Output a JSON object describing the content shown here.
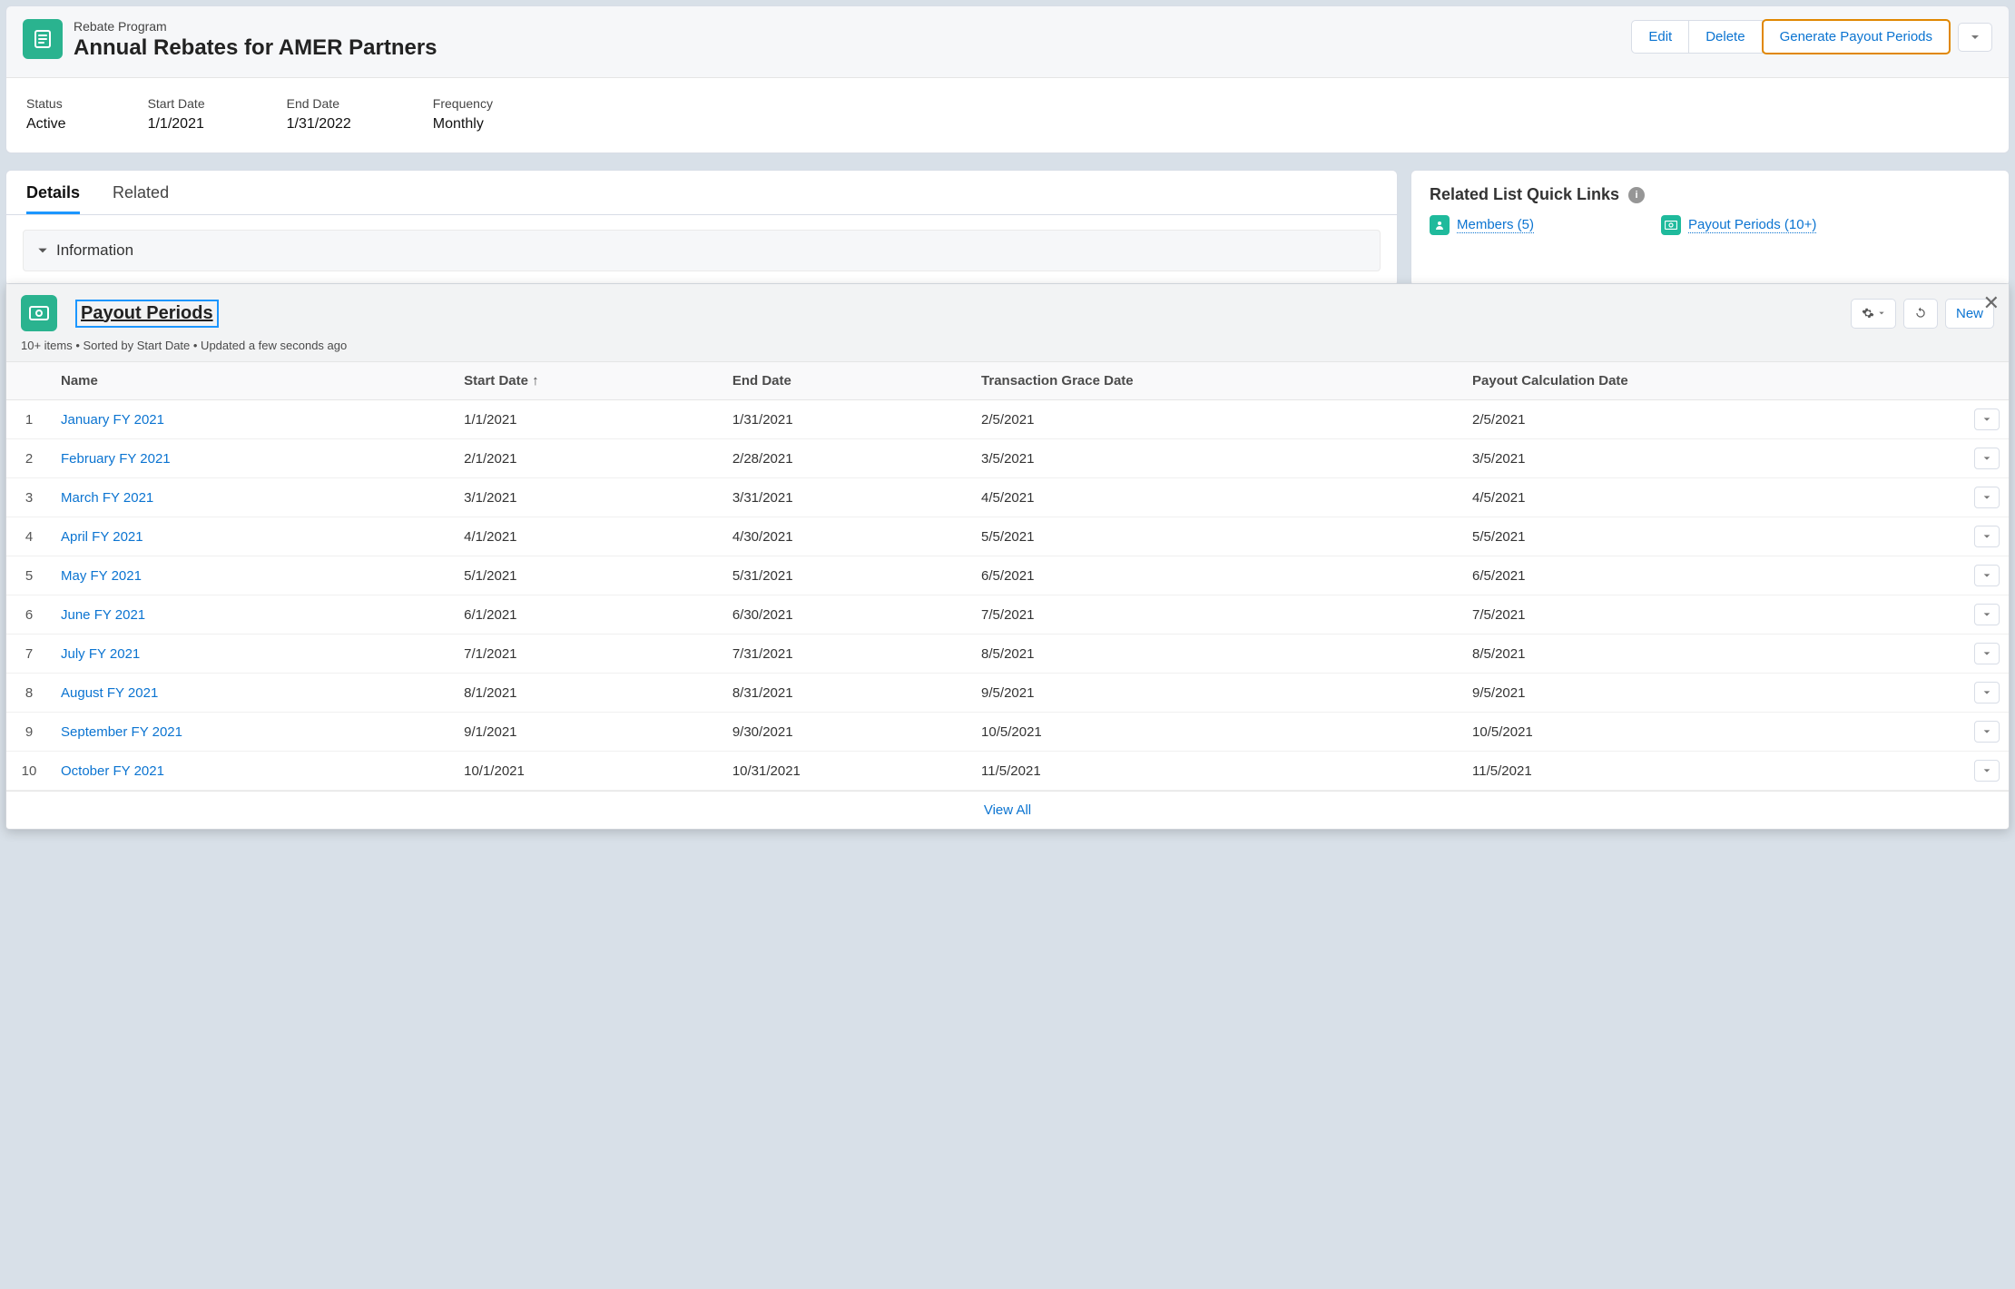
{
  "header": {
    "record_type": "Rebate Program",
    "title": "Annual Rebates for AMER Partners",
    "actions": {
      "edit": "Edit",
      "delete": "Delete",
      "generate": "Generate Payout Periods"
    }
  },
  "fields": [
    {
      "label": "Status",
      "value": "Active"
    },
    {
      "label": "Start Date",
      "value": "1/1/2021"
    },
    {
      "label": "End Date",
      "value": "1/31/2022"
    },
    {
      "label": "Frequency",
      "value": "Monthly"
    }
  ],
  "tabs": {
    "details": "Details",
    "related": "Related",
    "active": "details"
  },
  "section": {
    "info": "Information"
  },
  "related_quick": {
    "title": "Related List Quick Links",
    "members": "Members (5)",
    "payout": "Payout Periods (10+)"
  },
  "overlay": {
    "title": "Payout Periods",
    "subtitle": "10+ items • Sorted by Start Date • Updated a few seconds ago",
    "new_btn": "New",
    "columns": {
      "name": "Name",
      "start": "Start Date",
      "end": "End Date",
      "grace": "Transaction Grace Date",
      "calc": "Payout Calculation Date"
    },
    "rows": [
      {
        "n": "1",
        "name": "January FY 2021",
        "start": "1/1/2021",
        "end": "1/31/2021",
        "grace": "2/5/2021",
        "calc": "2/5/2021"
      },
      {
        "n": "2",
        "name": "February FY 2021",
        "start": "2/1/2021",
        "end": "2/28/2021",
        "grace": "3/5/2021",
        "calc": "3/5/2021"
      },
      {
        "n": "3",
        "name": "March FY 2021",
        "start": "3/1/2021",
        "end": "3/31/2021",
        "grace": "4/5/2021",
        "calc": "4/5/2021"
      },
      {
        "n": "4",
        "name": "April FY 2021",
        "start": "4/1/2021",
        "end": "4/30/2021",
        "grace": "5/5/2021",
        "calc": "5/5/2021"
      },
      {
        "n": "5",
        "name": "May FY 2021",
        "start": "5/1/2021",
        "end": "5/31/2021",
        "grace": "6/5/2021",
        "calc": "6/5/2021"
      },
      {
        "n": "6",
        "name": "June FY 2021",
        "start": "6/1/2021",
        "end": "6/30/2021",
        "grace": "7/5/2021",
        "calc": "7/5/2021"
      },
      {
        "n": "7",
        "name": "July FY 2021",
        "start": "7/1/2021",
        "end": "7/31/2021",
        "grace": "8/5/2021",
        "calc": "8/5/2021"
      },
      {
        "n": "8",
        "name": "August FY 2021",
        "start": "8/1/2021",
        "end": "8/31/2021",
        "grace": "9/5/2021",
        "calc": "9/5/2021"
      },
      {
        "n": "9",
        "name": "September FY 2021",
        "start": "9/1/2021",
        "end": "9/30/2021",
        "grace": "10/5/2021",
        "calc": "10/5/2021"
      },
      {
        "n": "10",
        "name": "October FY 2021",
        "start": "10/1/2021",
        "end": "10/31/2021",
        "grace": "11/5/2021",
        "calc": "11/5/2021"
      }
    ],
    "view_all": "View All"
  }
}
